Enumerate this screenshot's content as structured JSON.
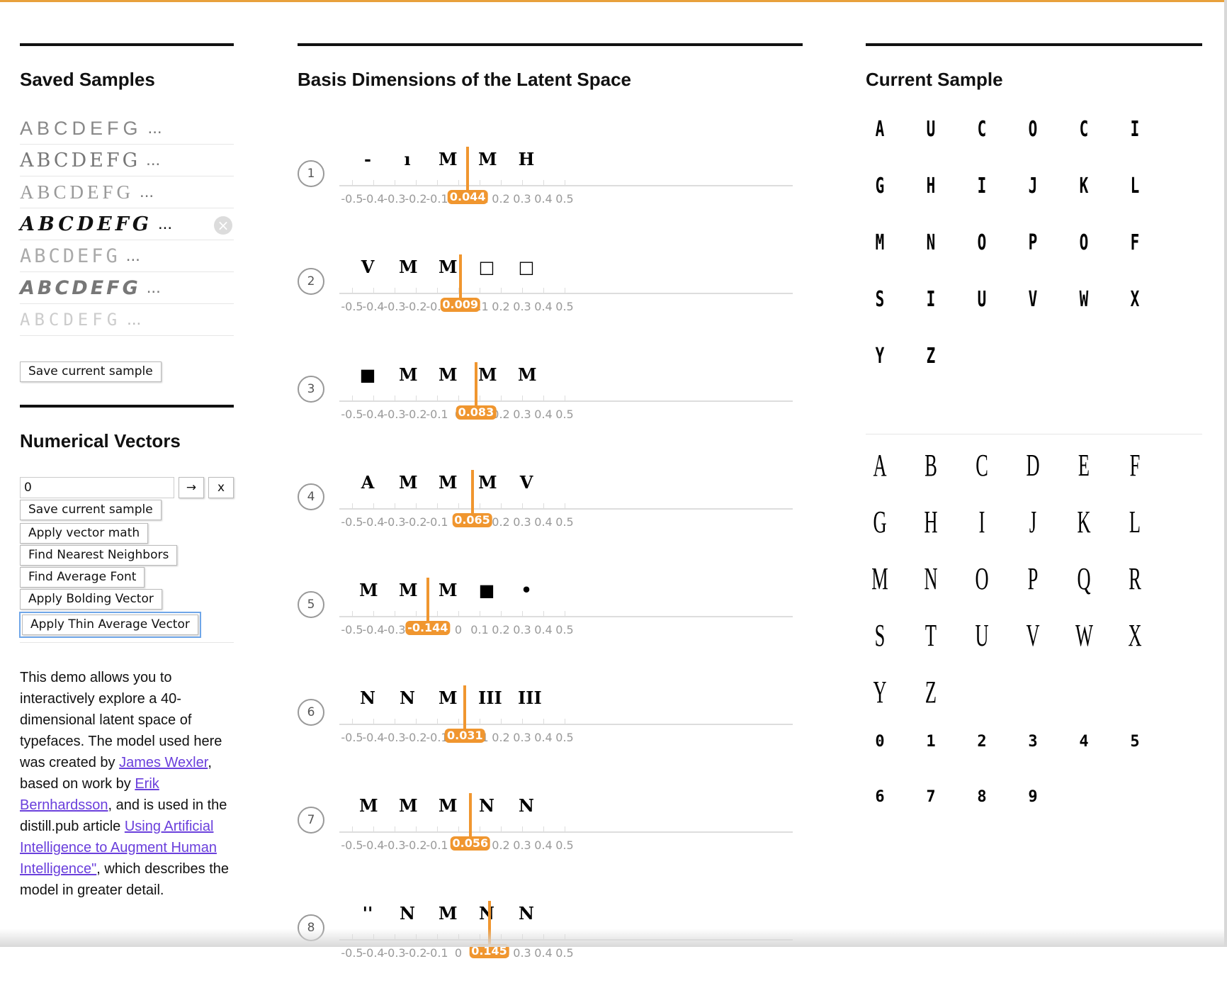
{
  "left": {
    "saved_title": "Saved Samples",
    "samples": [
      {
        "text": "ABCDEFG",
        "ellipsis": "..."
      },
      {
        "text": "ABCDEFG",
        "ellipsis": "..."
      },
      {
        "text": "ABCDEFG",
        "ellipsis": "..."
      },
      {
        "text": "ABCDEFG",
        "ellipsis": "..."
      },
      {
        "text": "ABCDEFG",
        "ellipsis": "..."
      },
      {
        "text": "ABCDEFG",
        "ellipsis": "..."
      },
      {
        "text": "ABCDEFG",
        "ellipsis": "..."
      }
    ],
    "remove_icon": "×",
    "save_button": "Save current sample",
    "vectors_title": "Numerical Vectors",
    "vector_input_value": "0",
    "go_icon": "→",
    "clear_label": "x",
    "actions": [
      "Save current sample",
      "Apply vector math",
      "Find Nearest Neighbors",
      "Find Average Font",
      "Apply Bolding Vector",
      "Apply Thin Average Vector"
    ],
    "desc": {
      "p1": "This demo allows you to interactively explore a 40-dimensional latent space of typefaces. The model used here was created by ",
      "link1": "James Wexler",
      "p2": ", based on work by ",
      "link2": "Erik Bernhardsson",
      "p3": ", and is used in the distill.pub article ",
      "link3": "Using Artificial Intelligence to Augment Human Intelligence\"",
      "p4": ", which describes the model in greater detail."
    }
  },
  "middle": {
    "title": "Basis Dimensions of the Latent Space",
    "tick_labels": [
      "-0.5",
      "-0.4",
      "-0.3",
      "-0.2",
      "-0.1",
      "0",
      "0.1",
      "0.2",
      "0.3",
      "0.4",
      "0.5"
    ],
    "dimensions": [
      {
        "index": "1",
        "value": 0.044,
        "value_label": "0.044",
        "glyphs": [
          "-",
          "ı",
          "M",
          "M",
          "H"
        ]
      },
      {
        "index": "2",
        "value": 0.009,
        "value_label": "0.009",
        "glyphs": [
          "V",
          "M",
          "M",
          "□",
          "□"
        ]
      },
      {
        "index": "3",
        "value": 0.083,
        "value_label": "0.083",
        "glyphs": [
          "■",
          "M",
          "M",
          "M",
          "M"
        ]
      },
      {
        "index": "4",
        "value": 0.065,
        "value_label": "0.065",
        "glyphs": [
          "A",
          "M",
          "M",
          "M",
          "V"
        ]
      },
      {
        "index": "5",
        "value": -0.144,
        "value_label": "-0.144",
        "glyphs": [
          "M",
          "M",
          "M",
          "■",
          "•"
        ]
      },
      {
        "index": "6",
        "value": 0.031,
        "value_label": "0.031",
        "glyphs": [
          "N",
          "N",
          "M",
          "III",
          "III"
        ]
      },
      {
        "index": "7",
        "value": 0.056,
        "value_label": "0.056",
        "glyphs": [
          "M",
          "M",
          "M",
          "N",
          "N"
        ]
      },
      {
        "index": "8",
        "value": 0.145,
        "value_label": "0.145",
        "glyphs": [
          "''",
          "N",
          "M",
          "N",
          "N"
        ]
      }
    ]
  },
  "right": {
    "title": "Current Sample",
    "sample_glyphs_1": [
      "A",
      "U",
      "C",
      "O",
      "C",
      "I",
      "G",
      "H",
      "I",
      "J",
      "K",
      "L",
      "M",
      "N",
      "O",
      "P",
      "O",
      "F",
      "S",
      "I",
      "U",
      "V",
      "W",
      "X",
      "Y",
      "Z"
    ],
    "sample_glyphs_2": [
      "A",
      "B",
      "C",
      "D",
      "E",
      "F",
      "G",
      "H",
      "I",
      "J",
      "K",
      "L",
      "M",
      "N",
      "O",
      "P",
      "Q",
      "R",
      "S",
      "T",
      "U",
      "V",
      "W",
      "X",
      "Y",
      "Z"
    ],
    "sample_glyphs_3": [
      "0",
      "1",
      "2",
      "3",
      "4",
      "5",
      "6",
      "7",
      "8",
      "9"
    ]
  }
}
